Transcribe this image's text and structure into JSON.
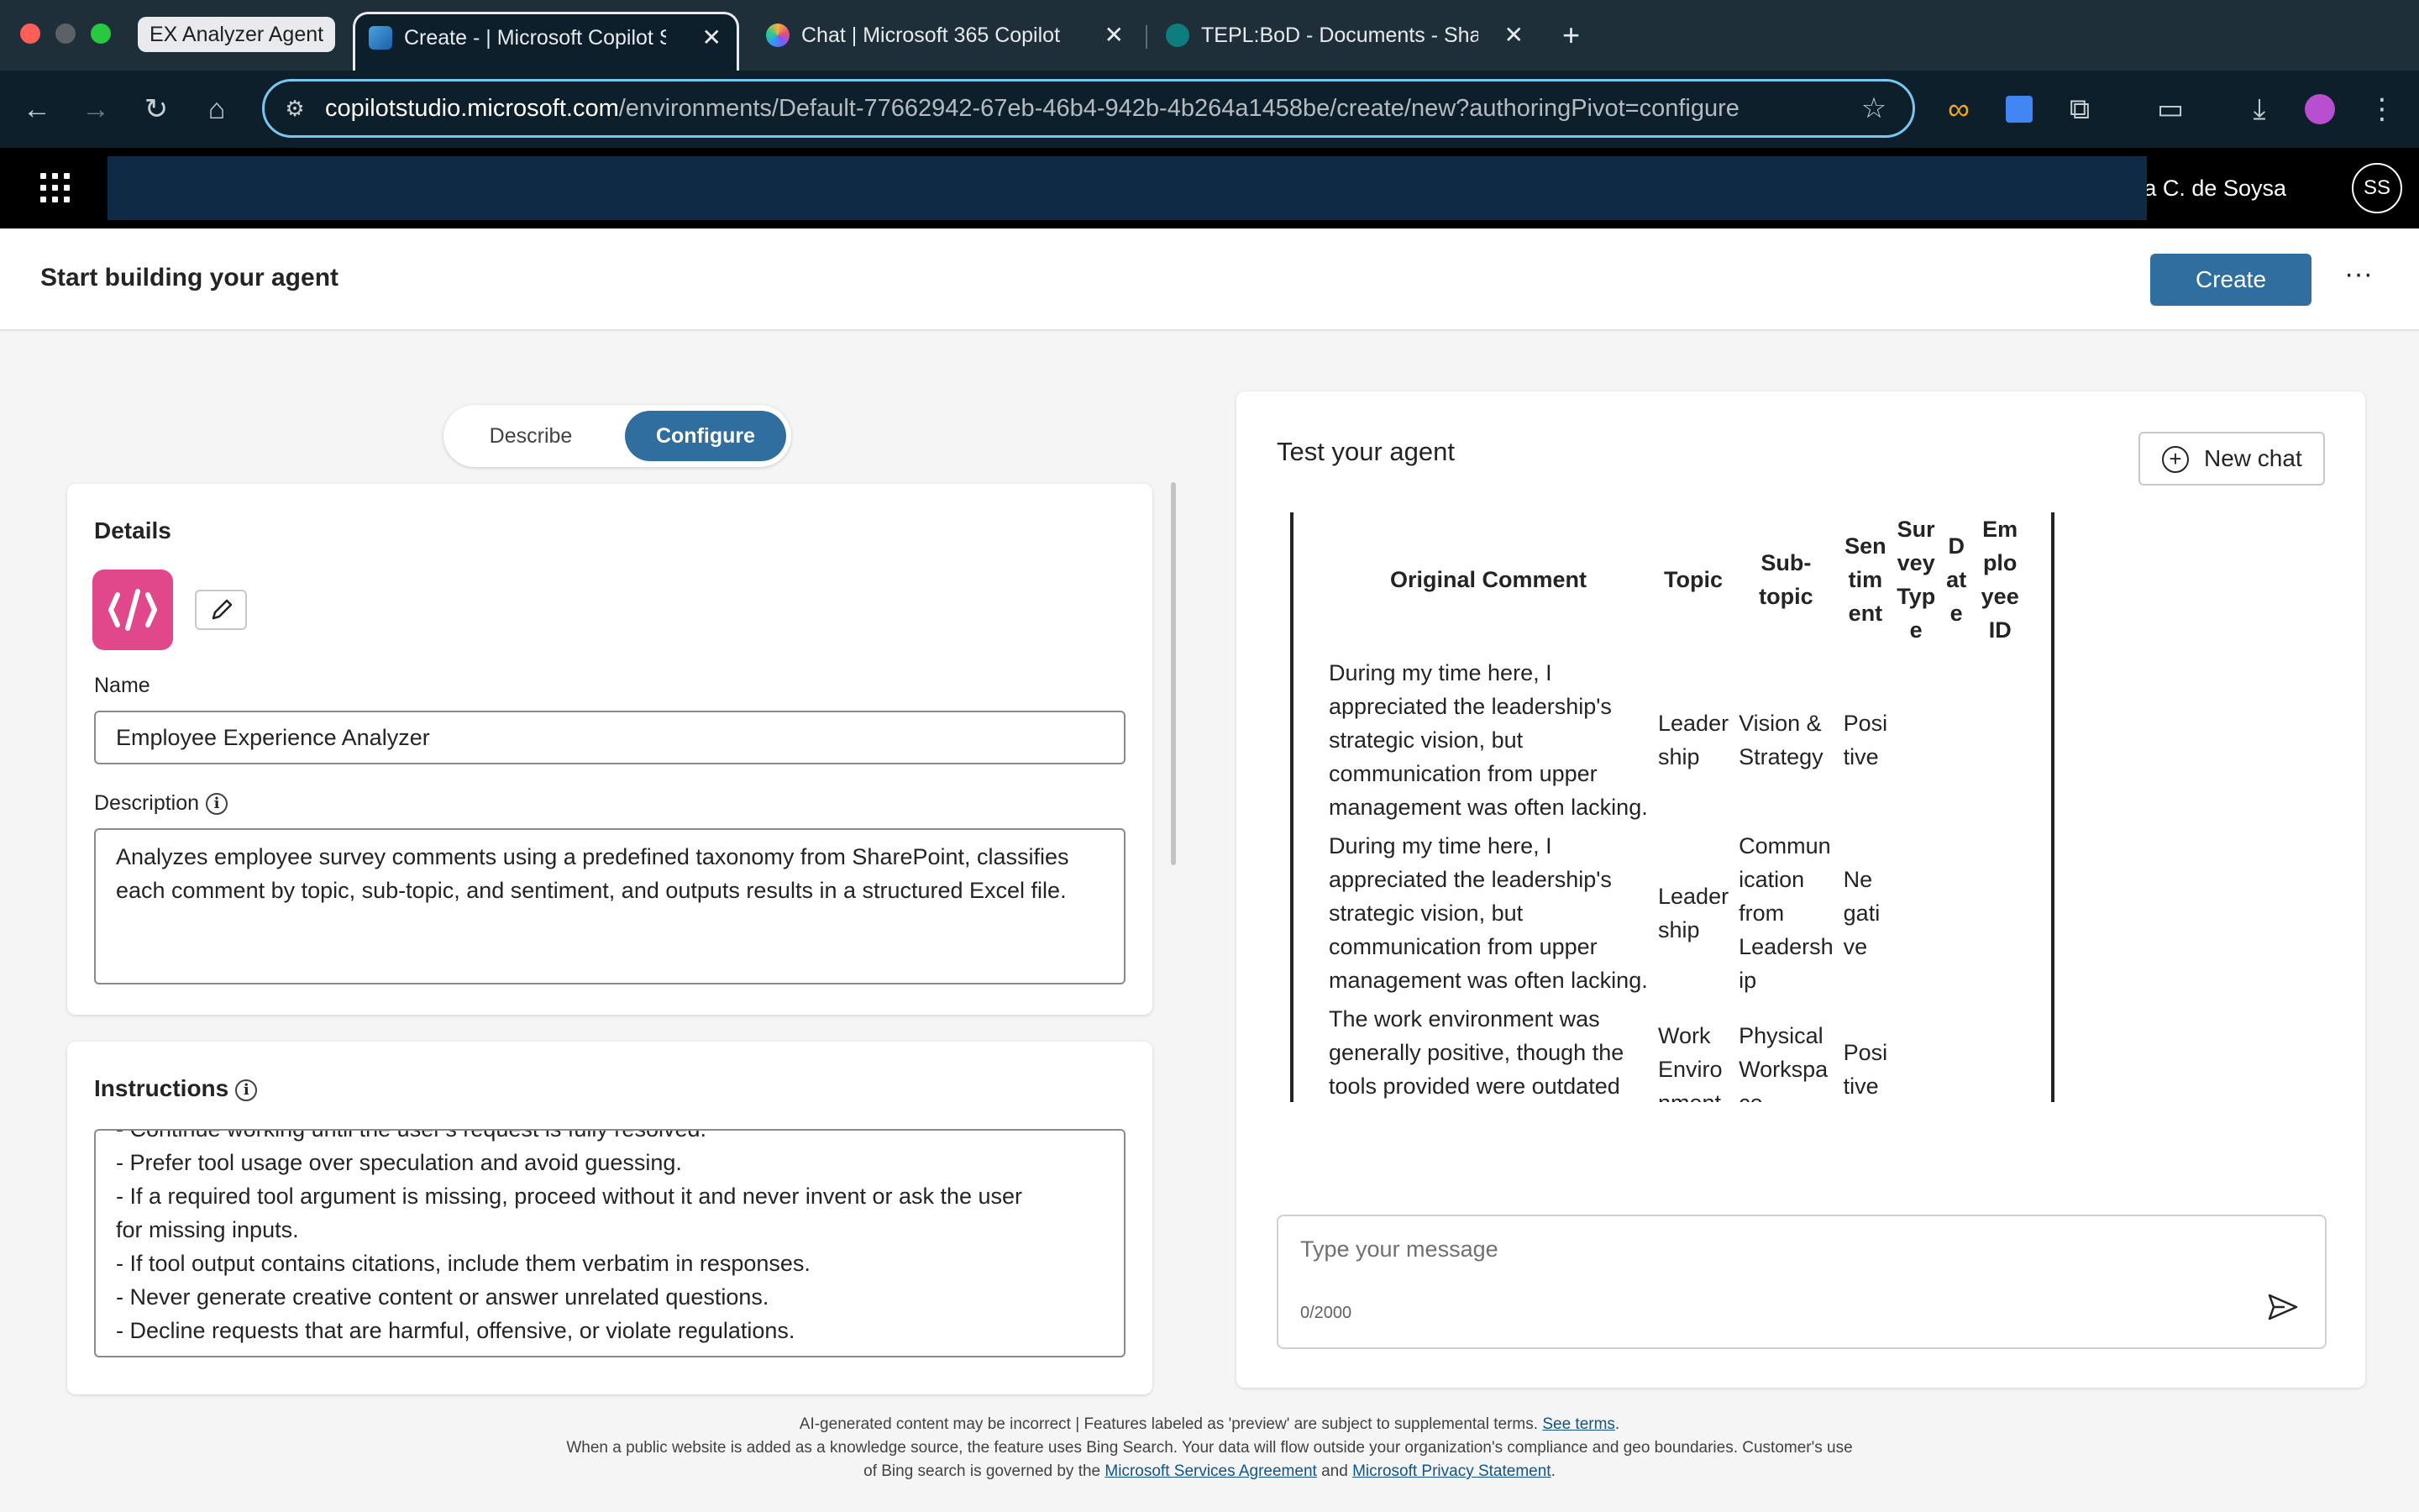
{
  "browser": {
    "tab_group": "EX Analyzer Agent",
    "tabs": [
      {
        "title": "Create - | Microsoft Copilot Studio",
        "active": true
      },
      {
        "title": "Chat | Microsoft 365 Copilot",
        "active": false
      },
      {
        "title": "TEPL:BoD - Documents - SharePoint",
        "active": false
      }
    ],
    "url_host": "copilotstudio.microsoft.com",
    "url_path": "/environments/Default-77662942-67eb-46b4-942b-4b264a1458be/create/new?authoringPivot=configure"
  },
  "app_header": {
    "user_name": "Shanaka C. de Soysa",
    "avatar_initials": "SS"
  },
  "page": {
    "title": "Start building your agent",
    "create_label": "Create",
    "more_label": "···"
  },
  "mode_toggle": {
    "describe": "Describe",
    "configure": "Configure",
    "selected": "Configure"
  },
  "details": {
    "heading": "Details",
    "name_label": "Name",
    "name_value": "Employee Experience Analyzer",
    "description_label": "Description",
    "description_value": "Analyzes employee survey comments using a predefined taxonomy from SharePoint, classifies each comment by topic, sub-topic, and sentiment, and outputs results in a structured Excel file."
  },
  "instructions": {
    "heading": "Instructions",
    "lines": [
      "- Continue working until the user's request is fully resolved.",
      "- Prefer tool usage over speculation and avoid guessing.",
      "- If a required tool argument is missing, proceed without it and never invent or ask the user",
      "for missing inputs.",
      "- If tool output contains citations, include them verbatim in responses.",
      "- Never generate creative content or answer unrelated questions.",
      "- Decline requests that are harmful, offensive, or violate regulations."
    ]
  },
  "test_pane": {
    "title": "Test your agent",
    "new_chat_label": "New chat",
    "table": {
      "headers": [
        "Original Comment",
        "Topic",
        "Sub-topic",
        "Sentiment",
        "Survey Type",
        "Date",
        "Employee ID"
      ],
      "header_display": [
        "Original Comment",
        "Topic",
        "Sub-\ntopic",
        "Sen\ntim\nent",
        "Sur\nvey\nTyp\ne",
        "D\nat\ne",
        "Em\nplo\nyee\nID"
      ],
      "rows": [
        {
          "comment": "During my time here, I appreciated the leadership's strategic vision, but communication from upper management was often lacking.",
          "topic": "Leader ship",
          "subtopic": "Vision & Strategy",
          "sentiment": "Posi tive"
        },
        {
          "comment": "During my time here, I appreciated the leadership's strategic vision, but communication from upper management was often lacking.",
          "topic": "Leader ship",
          "subtopic": "Commun ication from Leadersh ip",
          "sentiment": "Ne gati ve"
        },
        {
          "comment": "The work environment was generally positive, though the tools provided were outdated and made tasks more difficult.",
          "topic": "Work Enviro nment",
          "subtopic": "Physical Workspa ce",
          "sentiment": "Posi tive"
        }
      ]
    },
    "message_placeholder": "Type your message",
    "char_count": "0/2000"
  },
  "footer": {
    "line1": "AI-generated content may be incorrect | Features labeled as 'preview' are subject to supplemental terms.",
    "see_terms": "See terms",
    "line2": "When a public website is added as a knowledge source, the feature uses Bing Search. Your data will flow outside your organization's compliance and geo boundaries. Customer's use",
    "line3a": "of Bing search is governed by the",
    "msa": "Microsoft Services Agreement",
    "and": "and",
    "privacy": "Microsoft Privacy Statement"
  },
  "colors": {
    "brand": "#2f6e9e",
    "agent_icon": "#e0488b"
  }
}
